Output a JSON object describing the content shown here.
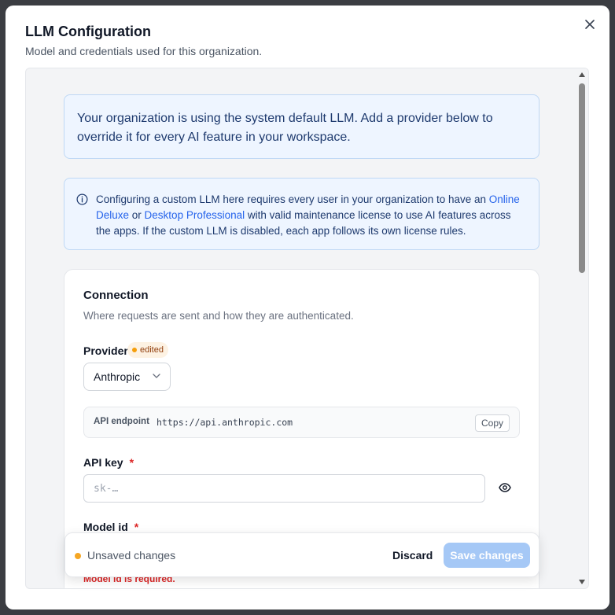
{
  "modal": {
    "title": "LLM Configuration",
    "subtitle": "Model and credentials used for this organization."
  },
  "banner_default": {
    "text": "Your organization is using the system default LLM. Add a provider below to override it for every AI feature in your workspace."
  },
  "banner_info": {
    "text_before": "Configuring a custom LLM here requires every user in your organization to have an ",
    "link_online": "Online Deluxe",
    "text_or": " or ",
    "link_desktop": "Desktop Professional",
    "text_after": " with valid maintenance license to use AI features across the apps. If the custom LLM is disabled, each app follows its own license rules."
  },
  "connection": {
    "title": "Connection",
    "description": "Where requests are sent and how they are authenticated.",
    "provider_label": "Provider",
    "required_mark": "*",
    "edited_badge": "edited",
    "provider_value": "Anthropic",
    "endpoint_label": "API endpoint",
    "endpoint_value": "https://api.anthropic.com",
    "copy_label": "Copy",
    "api_key_label": "API key",
    "api_key_placeholder": "sk-…",
    "model_id_label": "Model id",
    "model_id_error": "Model id is required."
  },
  "save_bar": {
    "status": "Unsaved changes",
    "discard_label": "Discard",
    "save_label": "Save changes"
  },
  "colors": {
    "accent": "#2563eb",
    "save_disabled": "#a5c8f6",
    "warning_dot": "#f5a623",
    "error": "#dc2626"
  },
  "icons": {
    "close": "close-icon",
    "info": "info-icon",
    "chevron": "chevron-down-icon",
    "eye": "eye-icon"
  }
}
